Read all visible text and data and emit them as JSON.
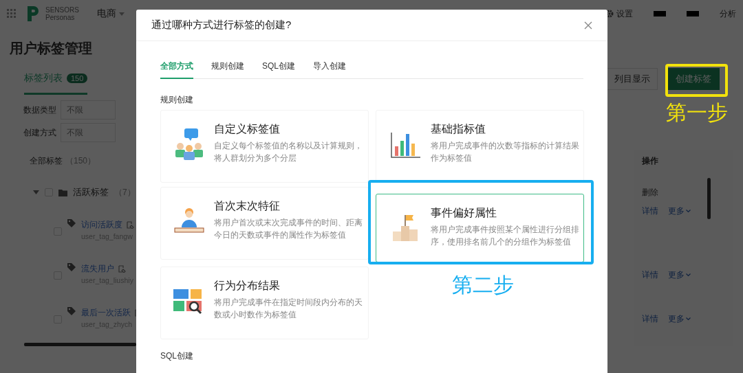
{
  "top_bar": {
    "brand_top": "SENSORS",
    "brand_bottom": "Personas",
    "project": "电商",
    "settings": "设置",
    "user": "分析"
  },
  "page": {
    "title": "用户标签管理",
    "tabs": [
      {
        "label": "标签列表",
        "count": "150",
        "selected": true
      }
    ],
    "filters": [
      {
        "label": "数据类型",
        "placeholder": "不限"
      },
      {
        "label": "创建方式",
        "placeholder": "不限"
      }
    ],
    "buttons": [
      {
        "label": "列目显示",
        "kind": "default"
      },
      {
        "label": "创建标签",
        "kind": "primary"
      }
    ],
    "tree": {
      "header": "全部标签",
      "count": "（150）",
      "groups": [
        {
          "name": "活跃标签",
          "count": "（7）",
          "expanded": true,
          "checked": false,
          "children": [
            {
              "name": "访问活跃度",
              "id": "user_tag_fangw",
              "checked": false
            },
            {
              "name": "流失用户",
              "id": "user_tag_liushiy",
              "checked": false
            },
            {
              "name": "最后一次活跃",
              "id": "user_tag_zhych",
              "checked": false
            }
          ]
        }
      ]
    },
    "operations": {
      "header": "操作",
      "rows": [
        {
          "links": [
            {
              "label": "删除",
              "disabled": true
            }
          ]
        },
        {
          "links": [
            {
              "label": "详情",
              "disabled": false
            },
            {
              "label": "更多",
              "disabled": false,
              "kind": "dropdown"
            }
          ]
        },
        {
          "links": [
            {
              "label": "详情",
              "disabled": false
            },
            {
              "label": "更多",
              "disabled": false,
              "kind": "dropdown"
            }
          ]
        },
        {
          "links": [
            {
              "label": "详情",
              "disabled": false
            },
            {
              "label": "更多",
              "disabled": false,
              "kind": "dropdown"
            }
          ]
        }
      ]
    }
  },
  "dialog": {
    "title": "通过哪种方式进行标签的创建?",
    "tabs": [
      {
        "label": "全部方式",
        "selected": true
      },
      {
        "label": "规则创建",
        "selected": false
      },
      {
        "label": "SQL创建",
        "selected": false
      },
      {
        "label": "导入创建",
        "selected": false
      }
    ],
    "sections": [
      {
        "title": "规则创建",
        "cards": [
          {
            "kind": "custom",
            "title": "自定义标签值",
            "description": "自定义每个标签值的名称以及计算规则，将人群划分为多个分层",
            "selected": false
          },
          {
            "kind": "metric",
            "title": "基础指标值",
            "description": "将用户完成事件的次数等指标的计算结果作为标签值",
            "selected": false
          },
          {
            "kind": "firstlast",
            "title": "首次末次特征",
            "description": "将用户首次或末次完成事件的时间、距离今日的天数或事件的属性作为标签值",
            "selected": false
          },
          {
            "kind": "preference",
            "title": "事件偏好属性",
            "description": "将用户完成事件按照某个属性进行分组排序，使用排名前几个的分组作为标签值",
            "selected": true
          },
          {
            "kind": "distribution",
            "title": "行为分布结果",
            "description": "将用户完成事件在指定时间段内分布的天数或小时数作为标签值",
            "selected": false
          }
        ]
      },
      {
        "title": "SQL创建"
      }
    ]
  },
  "annotations": [
    {
      "kind": "button",
      "label": "第一步",
      "color": "#f2e20c"
    },
    {
      "kind": "card",
      "label": "第二步",
      "color": "#17aef0"
    }
  ]
}
